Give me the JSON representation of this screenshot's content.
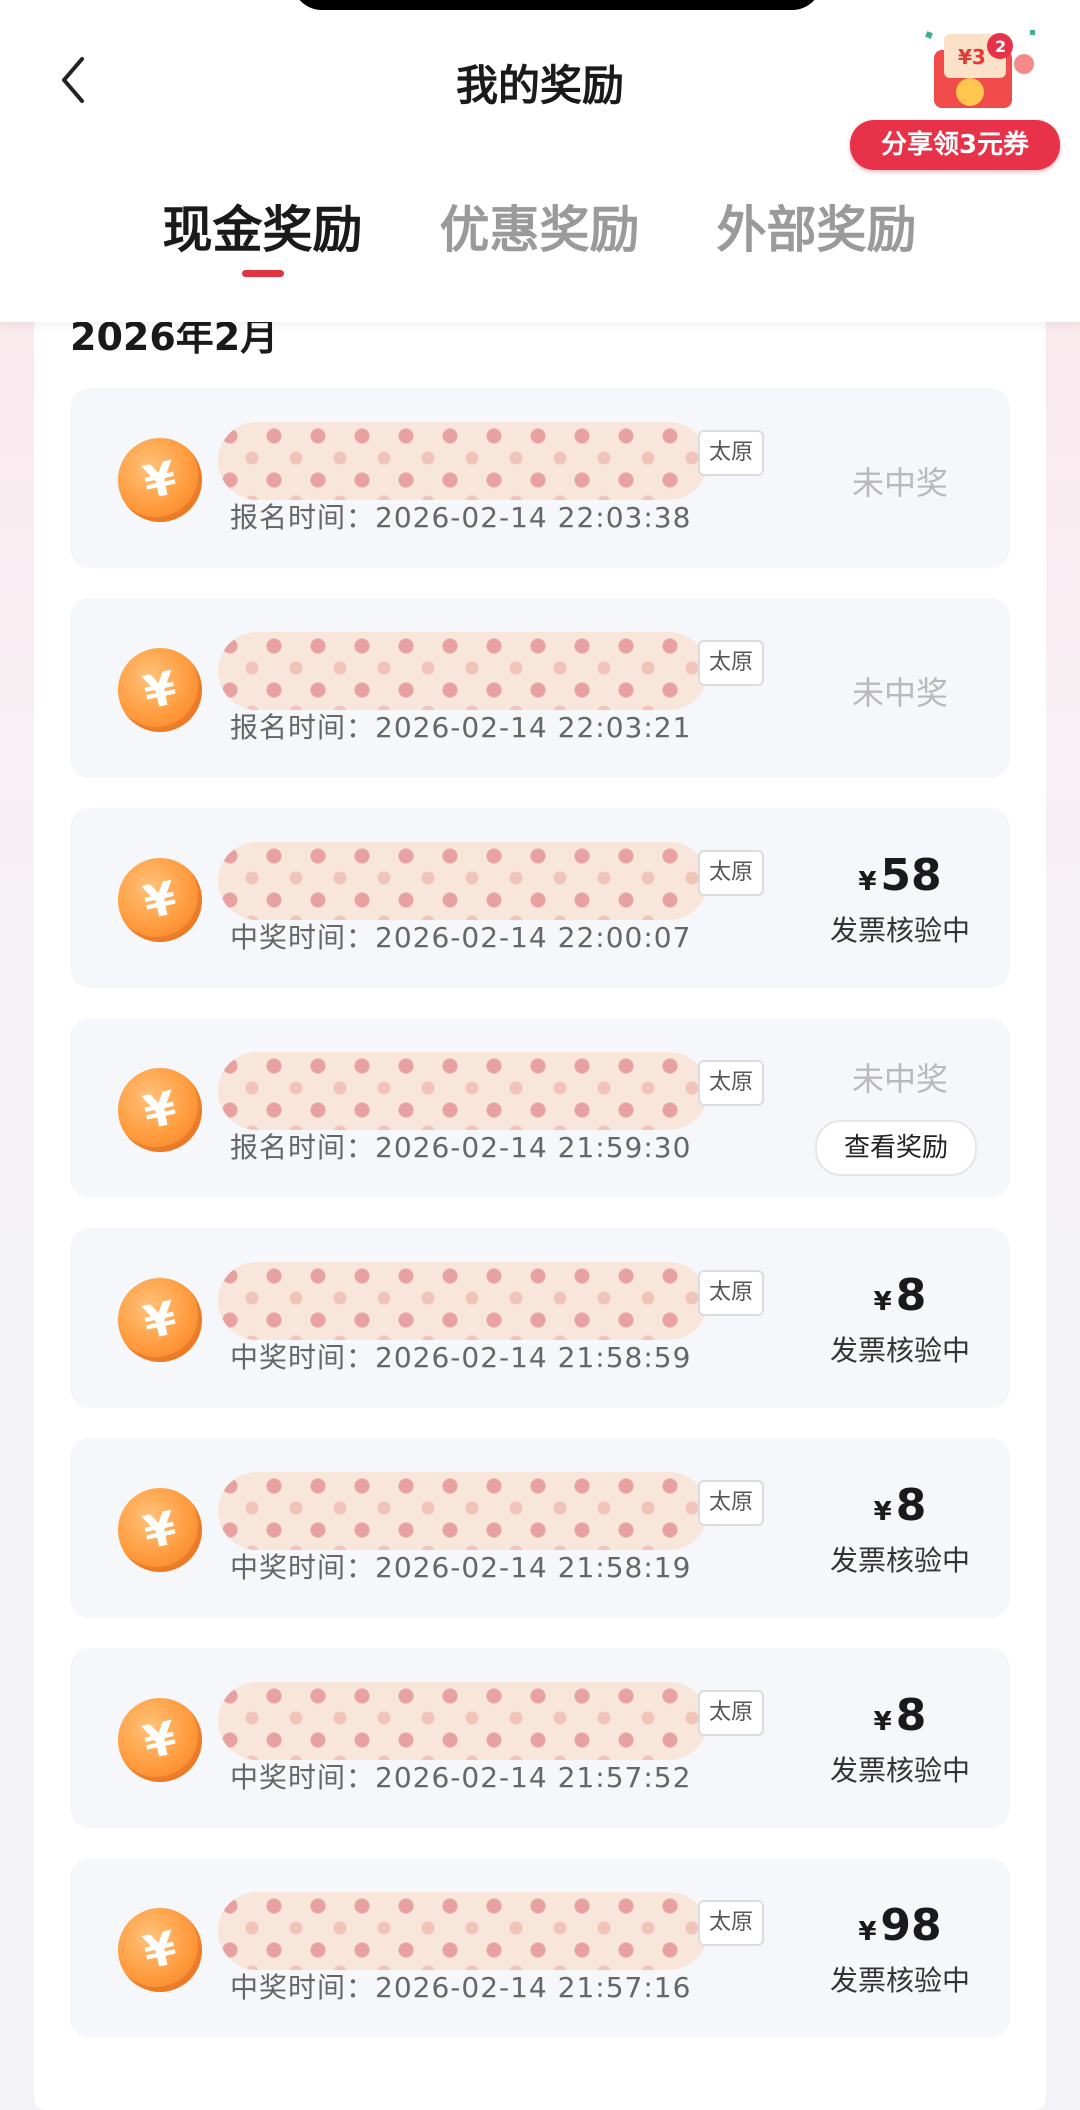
{
  "header": {
    "title": "我的奖励",
    "share_promo": {
      "label": "分享领3元券",
      "badge_amount": "¥3",
      "badge_count": "2"
    }
  },
  "tabs": [
    {
      "label": "现金奖励",
      "active": true
    },
    {
      "label": "优惠奖励",
      "active": false
    },
    {
      "label": "外部奖励",
      "active": false
    }
  ],
  "month_label": "2026年2月",
  "icon_names": {
    "back": "chevron-left-icon",
    "coin": "yuan-coin-icon",
    "gift": "red-envelope-gift-icon"
  },
  "colors": {
    "accent": "#e1343f",
    "promo": "#e8324a",
    "coin": "#ff9a3c"
  },
  "records": [
    {
      "city": "太原",
      "time_label": "报名时间：",
      "time": "2026-02-14 22:03:38",
      "status": "未中奖"
    },
    {
      "city": "太原",
      "time_label": "报名时间：",
      "time": "2026-02-14 22:03:21",
      "status": "未中奖"
    },
    {
      "city": "太原",
      "time_label": "中奖时间：",
      "time": "2026-02-14 22:00:07",
      "currency": "¥",
      "amount": "58",
      "status": "发票核验中"
    },
    {
      "city": "太原",
      "time_label": "报名时间：",
      "time": "2026-02-14 21:59:30",
      "status": "未中奖",
      "action": "查看奖励"
    },
    {
      "city": "太原",
      "time_label": "中奖时间：",
      "time": "2026-02-14 21:58:59",
      "currency": "¥",
      "amount": "8",
      "status": "发票核验中"
    },
    {
      "city": "太原",
      "time_label": "中奖时间：",
      "time": "2026-02-14 21:58:19",
      "currency": "¥",
      "amount": "8",
      "status": "发票核验中"
    },
    {
      "city": "太原",
      "time_label": "中奖时间：",
      "time": "2026-02-14 21:57:52",
      "currency": "¥",
      "amount": "8",
      "status": "发票核验中"
    },
    {
      "city": "太原",
      "time_label": "中奖时间：",
      "time": "2026-02-14 21:57:16",
      "currency": "¥",
      "amount": "98",
      "status": "发票核验中"
    }
  ]
}
